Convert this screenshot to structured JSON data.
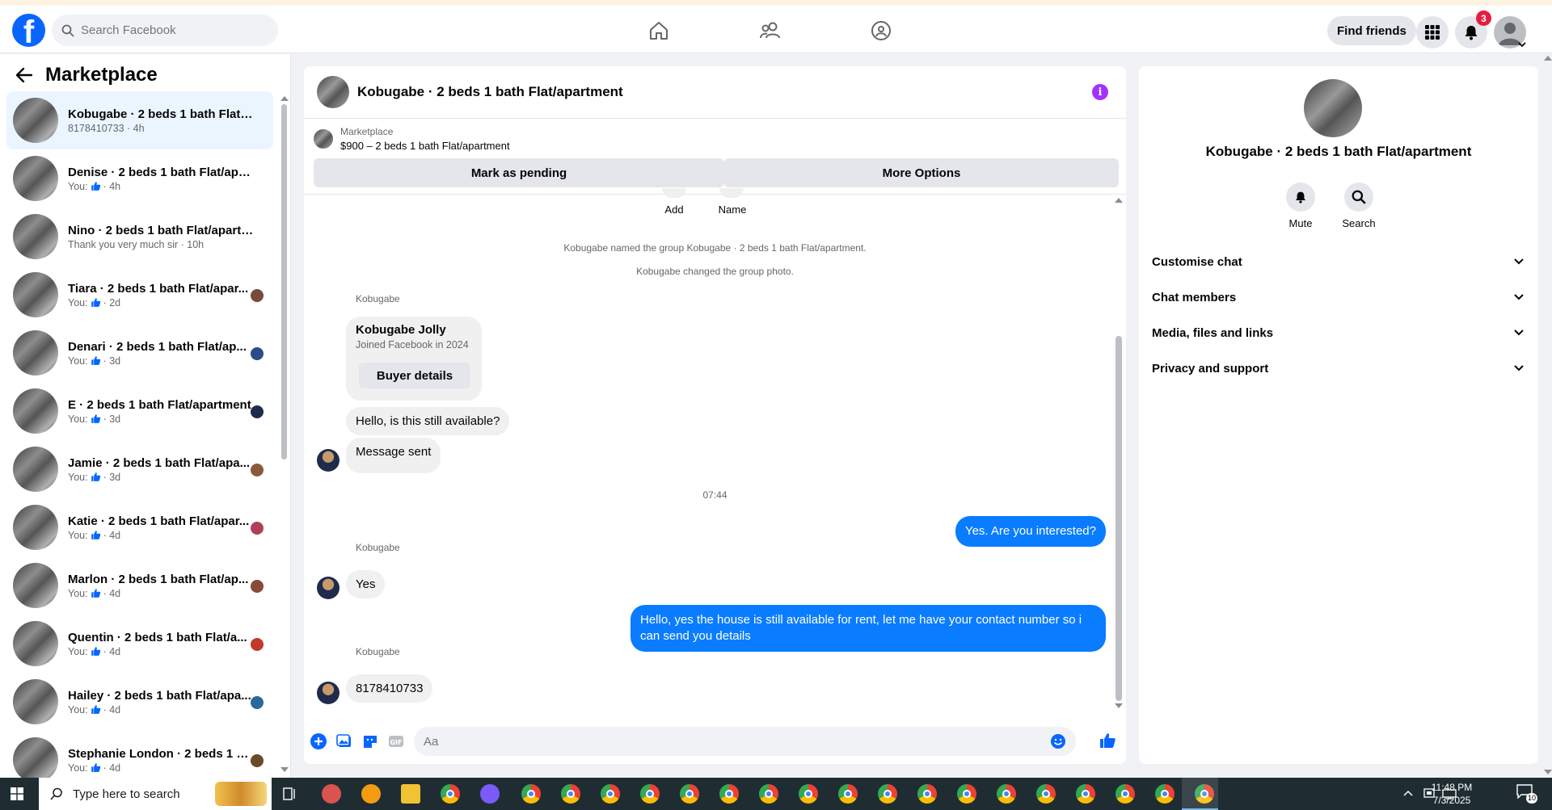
{
  "header": {
    "search_placeholder": "Search Facebook",
    "find_friends": "Find friends",
    "notification_count": "3",
    "logo_letter": "f"
  },
  "sidebar": {
    "title": "Marketplace",
    "conversations": [
      {
        "name": "Kobugabe · 2 beds 1 bath Flat/a...",
        "sub": "8178410733 · 4h",
        "liked": false,
        "active": true
      },
      {
        "name": "Denise · 2 beds 1 bath Flat/apart...",
        "sub_prefix": "You:",
        "sub": "· 4h",
        "liked": true
      },
      {
        "name": "Nino · 2 beds 1 bath Flat/apartm...",
        "sub": "Thank you very much sir · 10h",
        "liked": false
      },
      {
        "name": "Tiara · 2 beds 1 bath Flat/apar...",
        "sub_prefix": "You:",
        "sub": "· 2d",
        "liked": true
      },
      {
        "name": "Denari · 2 beds 1 bath Flat/ap...",
        "sub_prefix": "You:",
        "sub": "· 3d",
        "liked": true
      },
      {
        "name": "E · 2 beds 1 bath Flat/apartment",
        "sub_prefix": "You:",
        "sub": "· 3d",
        "liked": true
      },
      {
        "name": "Jamie · 2 beds 1 bath Flat/apa...",
        "sub_prefix": "You:",
        "sub": "· 3d",
        "liked": true
      },
      {
        "name": "Katie · 2 beds 1 bath Flat/apar...",
        "sub_prefix": "You:",
        "sub": "· 4d",
        "liked": true
      },
      {
        "name": "Marlon · 2 beds 1 bath Flat/ap...",
        "sub_prefix": "You:",
        "sub": "· 4d",
        "liked": true
      },
      {
        "name": "Quentin · 2 beds 1 bath Flat/a...",
        "sub_prefix": "You:",
        "sub": "· 4d",
        "liked": true
      },
      {
        "name": "Hailey · 2 beds 1 bath Flat/apa...",
        "sub_prefix": "You:",
        "sub": "· 4d",
        "liked": true
      },
      {
        "name": "Stephanie London · 2 beds 1 b...",
        "sub_prefix": "You:",
        "sub": "· 4d",
        "liked": true
      }
    ]
  },
  "chat": {
    "title": "Kobugabe · 2 beds 1 bath Flat/apartment",
    "listing_source": "Marketplace",
    "listing_title": "$900 – 2 beds 1 bath Flat/apartment",
    "mark_pending": "Mark as pending",
    "more_options": "More Options",
    "top_actions": {
      "add": "Add",
      "name": "Name"
    },
    "system_1": "Kobugabe named the group Kobugabe · 2 beds 1 bath Flat/apartment.",
    "system_2": "Kobugabe changed the group photo.",
    "sender": "Kobugabe",
    "buyer_card": {
      "name": "Kobugabe Jolly",
      "sub": "Joined Facebook in 2024",
      "button": "Buyer details"
    },
    "msg_1": "Hello, is this still available?",
    "msg_2": "Message sent",
    "time_divider": "07:44",
    "out_1": "Yes. Are you interested?",
    "in_3": "Yes",
    "out_2": "Hello, yes the house is still available for rent, let me have your contact number so i can send you details",
    "in_4": "8178410733",
    "composer_placeholder": "Aa"
  },
  "details": {
    "title": "Kobugabe · 2 beds 1 bath Flat/apartment",
    "mute": "Mute",
    "search": "Search",
    "sections": [
      "Customise chat",
      "Chat members",
      "Media, files and links",
      "Privacy and support"
    ]
  },
  "taskbar": {
    "search_placeholder": "Type here to search",
    "time": "11:48 PM",
    "date": "7/3/2025",
    "notif_count": "10"
  },
  "colors": {
    "brand": "#0866ff",
    "outgoing_bubble": "#0a7cff",
    "badge": "#e41e3f",
    "info": "#a033ff"
  }
}
